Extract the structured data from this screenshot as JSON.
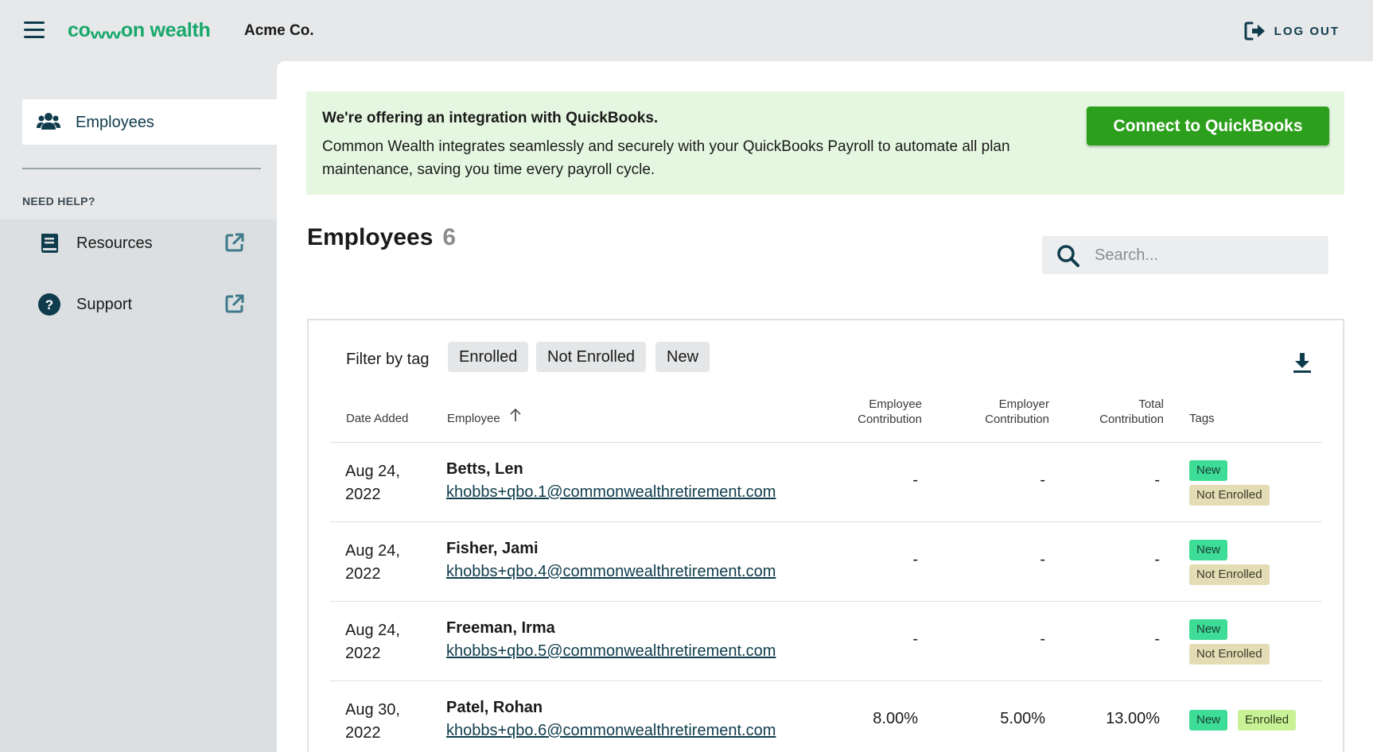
{
  "header": {
    "logo_prefix": "co",
    "logo_w": "ww",
    "logo_suffix": "on wealth",
    "company": "Acme Co.",
    "logout_label": "LOG OUT"
  },
  "sidebar": {
    "active_item": "Employees",
    "need_help": "NEED HELP?",
    "links": [
      {
        "label": "Resources",
        "icon": "book-icon"
      },
      {
        "label": "Support",
        "icon": "question-circle-icon"
      }
    ]
  },
  "banner": {
    "title": "We're offering an integration with QuickBooks.",
    "body": "Common Wealth integrates seamlessly and securely with your QuickBooks Payroll to automate all plan maintenance, saving you time every payroll cycle.",
    "button": "Connect to QuickBooks"
  },
  "employees": {
    "title": "Employees",
    "count": "6",
    "search_placeholder": "Search...",
    "filter_label": "Filter by tag",
    "filters": [
      "Enrolled",
      "Not Enrolled",
      "New"
    ],
    "columns": {
      "date_added": "Date Added",
      "employee": "Employee",
      "employee_contribution_1": "Employee",
      "employee_contribution_2": "Contribution",
      "employer_contribution_1": "Employer",
      "employer_contribution_2": "Contribution",
      "total_contribution_1": "Total",
      "total_contribution_2": "Contribution",
      "tags": "Tags"
    },
    "rows": [
      {
        "date_line1": "Aug 24,",
        "date_line2": "2022",
        "name": "Betts, Len",
        "email": "khobbs+qbo.1@commonwealthretirement.com",
        "employee": "-",
        "employer": "-",
        "total": "-",
        "tag1": "New",
        "tag2": "Not Enrolled"
      },
      {
        "date_line1": "Aug 24,",
        "date_line2": "2022",
        "name": "Fisher, Jami",
        "email": "khobbs+qbo.4@commonwealthretirement.com",
        "employee": "-",
        "employer": "-",
        "total": "-",
        "tag1": "New",
        "tag2": "Not Enrolled"
      },
      {
        "date_line1": "Aug 24,",
        "date_line2": "2022",
        "name": "Freeman, Irma",
        "email": "khobbs+qbo.5@commonwealthretirement.com",
        "employee": "-",
        "employer": "-",
        "total": "-",
        "tag1": "New",
        "tag2": "Not Enrolled"
      },
      {
        "date_line1": "Aug 30,",
        "date_line2": "2022",
        "name": "Patel, Rohan",
        "email": "khobbs+qbo.6@commonwealthretirement.com",
        "employee": "8.00%",
        "employer": "5.00%",
        "total": "13.00%",
        "tag1": "New",
        "tag2": "Enrolled"
      }
    ]
  },
  "colors": {
    "brand_green": "#17a86a",
    "quickbooks_green": "#2ca01c",
    "banner_bg": "#e5f7e0",
    "tag_new": "#3ddc97",
    "tag_not_enrolled": "#e3dcb4",
    "tag_enrolled": "#c9f296",
    "navy": "#0f3c4c"
  }
}
